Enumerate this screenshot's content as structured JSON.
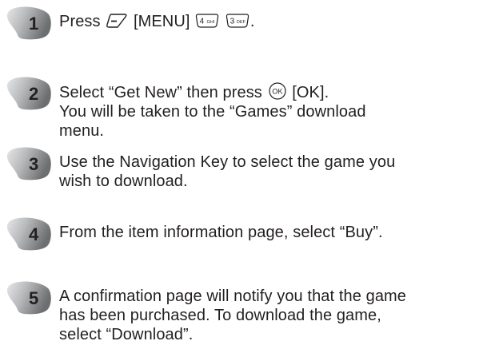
{
  "steps": [
    {
      "number": "1",
      "lines": [
        {
          "parts": [
            {
              "text": "Press "
            },
            {
              "key": "menu-softkey-icon"
            },
            {
              "text": " [MENU] "
            },
            {
              "key": "key-4-icon",
              "label": "4",
              "sub": "GHI"
            },
            {
              "text": " "
            },
            {
              "key": "key-3-icon",
              "label": "3",
              "sub": "DEF"
            },
            {
              "text": "."
            }
          ]
        }
      ]
    },
    {
      "number": "2",
      "lines": [
        {
          "parts": [
            {
              "text": "Select “Get New” then press "
            },
            {
              "key": "ok-key-icon",
              "label": "OK"
            },
            {
              "text": " [OK]."
            }
          ]
        },
        {
          "parts": [
            {
              "text": "You will be taken to the “Games” download"
            }
          ]
        },
        {
          "parts": [
            {
              "text": "menu."
            }
          ]
        }
      ]
    },
    {
      "number": "3",
      "lines": [
        {
          "parts": [
            {
              "text": "Use the Navigation Key to select the game you"
            }
          ]
        },
        {
          "parts": [
            {
              "text": "wish to download."
            }
          ]
        }
      ]
    },
    {
      "number": "4",
      "lines": [
        {
          "parts": [
            {
              "text": "From the item information page, select “Buy”."
            }
          ]
        }
      ]
    },
    {
      "number": "5",
      "lines": [
        {
          "parts": [
            {
              "text": "A confirmation page will notify you that the game"
            }
          ]
        },
        {
          "parts": [
            {
              "text": "has been purchased. To download the game,"
            }
          ]
        },
        {
          "parts": [
            {
              "text": "select “Download”."
            }
          ]
        }
      ]
    }
  ],
  "colors": {
    "text": "#231f20",
    "badge_dark": "#6d6e70",
    "badge_light": "#e6e7e8"
  }
}
